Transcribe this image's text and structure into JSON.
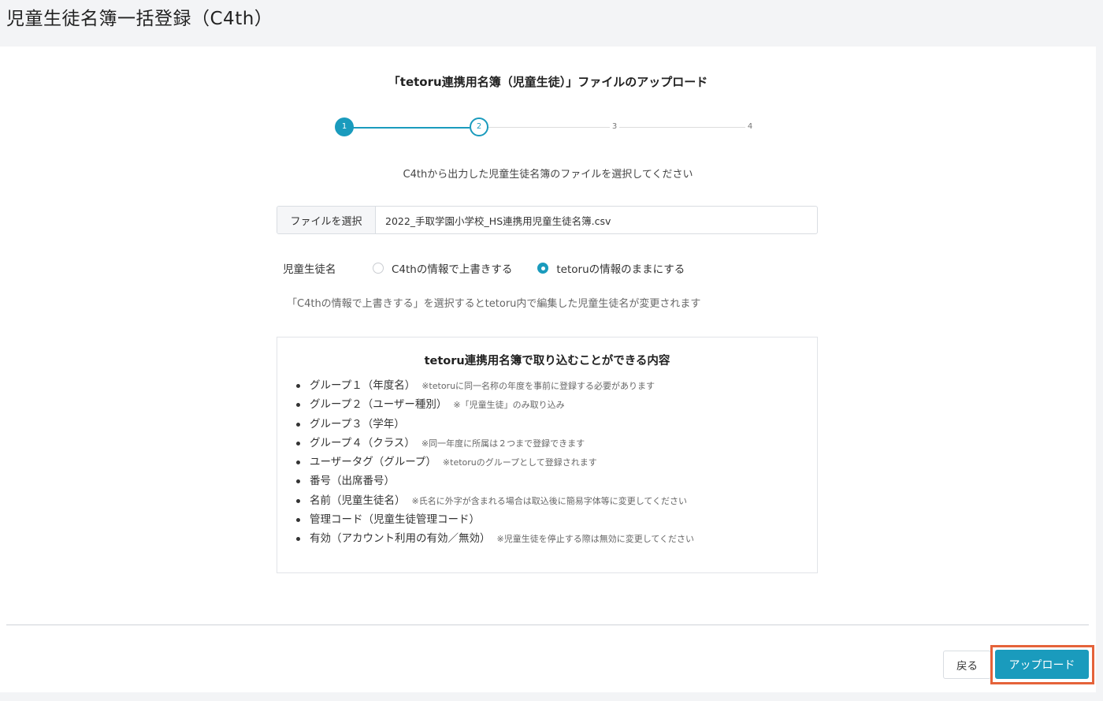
{
  "page": {
    "title": "児童生徒名簿一括登録（C4th）"
  },
  "upload": {
    "title": "「tetoru連携用名簿（児童生徒）」ファイルのアップロード",
    "steps": [
      "1",
      "2",
      "3",
      "4"
    ],
    "current_step": 2,
    "instruction": "C4thから出力した児童生徒名簿のファイルを選択してください",
    "file_button_label": "ファイルを選択",
    "file_name": "2022_手取学園小学校_HS連携用児童生徒名簿.csv"
  },
  "name_option": {
    "label": "児童生徒名",
    "options": [
      {
        "label": "C4thの情報で上書きする",
        "checked": false
      },
      {
        "label": "tetoruの情報のままにする",
        "checked": true
      }
    ],
    "note": "「C4thの情報で上書きする」を選択するとtetoru内で編集した児童生徒名が変更されます"
  },
  "info": {
    "title": "tetoru連携用名簿で取り込むことができる内容",
    "items": [
      {
        "text": "グループ１（年度名）",
        "note": "※tetoruに同一名称の年度を事前に登録する必要があります"
      },
      {
        "text": "グループ２（ユーザー種別）",
        "note": "※「児童生徒」のみ取り込み"
      },
      {
        "text": "グループ３（学年）",
        "note": ""
      },
      {
        "text": "グループ４（クラス）",
        "note": "※同一年度に所属は２つまで登録できます"
      },
      {
        "text": "ユーザータグ（グループ）",
        "note": "※tetoruのグループとして登録されます"
      },
      {
        "text": "番号（出席番号）",
        "note": ""
      },
      {
        "text": "名前（児童生徒名）",
        "note": "※氏名に外字が含まれる場合は取込後に簡易字体等に変更してください"
      },
      {
        "text": "管理コード（児童生徒管理コード）",
        "note": ""
      },
      {
        "text": "有効（アカウント利用の有効／無効）",
        "note": "※児童生徒を停止する際は無効に変更してください"
      }
    ]
  },
  "footer": {
    "back_label": "戻る",
    "upload_label": "アップロード"
  },
  "colors": {
    "accent": "#1a9bbd",
    "highlight": "#e5633a"
  }
}
